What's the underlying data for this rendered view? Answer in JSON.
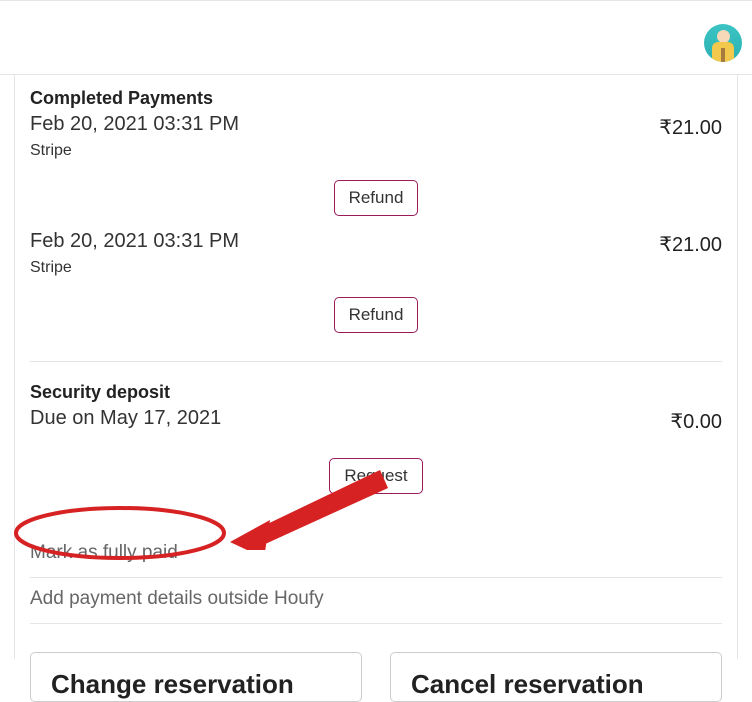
{
  "sections": {
    "completed_title": "Completed Payments",
    "security_title": "Security deposit"
  },
  "payments": [
    {
      "date": "Feb 20, 2021 03:31 PM",
      "method": "Stripe",
      "amount": "₹21.00",
      "action": "Refund"
    },
    {
      "date": "Feb 20, 2021 03:31 PM",
      "method": "Stripe",
      "amount": "₹21.00",
      "action": "Refund"
    }
  ],
  "deposit": {
    "due": "Due on May 17, 2021",
    "amount": "₹0.00",
    "action": "Request"
  },
  "links": {
    "mark_paid": "Mark as fully paid",
    "add_payment": "Add payment details outside Houfy"
  },
  "actions": {
    "change": "Change reservation",
    "cancel": "Cancel reservation"
  },
  "annotation_color": "#d62222"
}
